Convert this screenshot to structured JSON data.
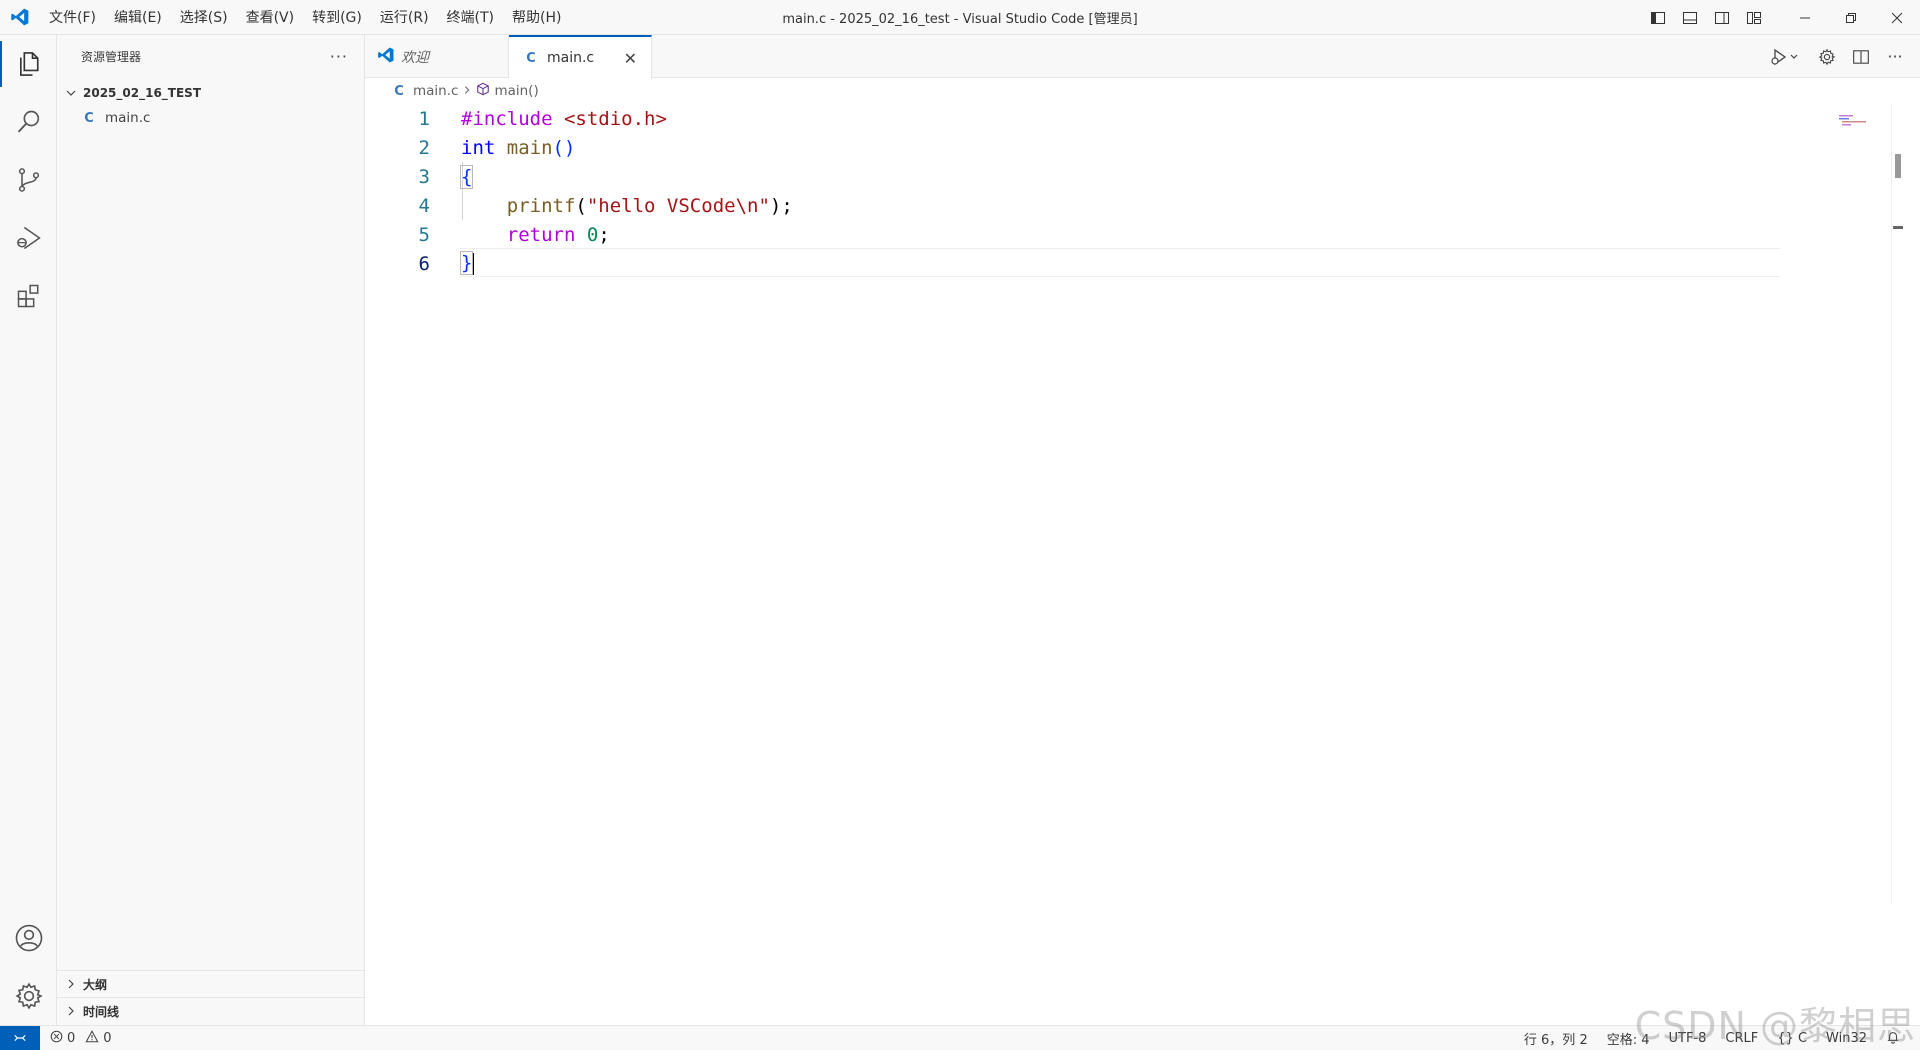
{
  "window": {
    "title": "main.c - 2025_02_16_test - Visual Studio Code [管理员]"
  },
  "menu": [
    "文件(F)",
    "编辑(E)",
    "选择(S)",
    "查看(V)",
    "转到(G)",
    "运行(R)",
    "终端(T)",
    "帮助(H)"
  ],
  "sidebar": {
    "title": "资源管理器",
    "more": "···",
    "folder": "2025_02_16_TEST",
    "file_icon": "C",
    "file": "main.c",
    "sections": [
      "大纲",
      "时间线"
    ]
  },
  "tabs": {
    "welcome": "欢迎",
    "active": "main.c",
    "close": "✕"
  },
  "breadcrumb": {
    "file": "main.c",
    "symbol": "main()"
  },
  "code": {
    "line_numbers": [
      "1",
      "2",
      "3",
      "4",
      "5",
      "6"
    ],
    "current_line": 6,
    "l1_directive": "#include",
    "l1_header": "<stdio.h>",
    "l2_type": "int",
    "l2_fn": "main",
    "l2_parens": "()",
    "l3": "{",
    "l4_fn": "printf",
    "l4_open": "(",
    "l4_str": "\"hello VSCode\\n\"",
    "l4_close": ");",
    "l5_kw": "return",
    "l5_num": "0",
    "l5_semi": ";",
    "l6": "}"
  },
  "status": {
    "errors": "0",
    "warnings": "0",
    "position": "行 6，列 2",
    "spaces": "空格: 4",
    "encoding": "UTF-8",
    "eol": "CRLF",
    "language": "{} C",
    "platform": "Win32"
  },
  "watermark": "CSDN @黎相思",
  "colors": {
    "accent": "#005fb8",
    "keyword_preprocessor": "#af00db",
    "keyword_type": "#0000ff",
    "function": "#795e26",
    "string": "#a31515",
    "number": "#098658"
  }
}
